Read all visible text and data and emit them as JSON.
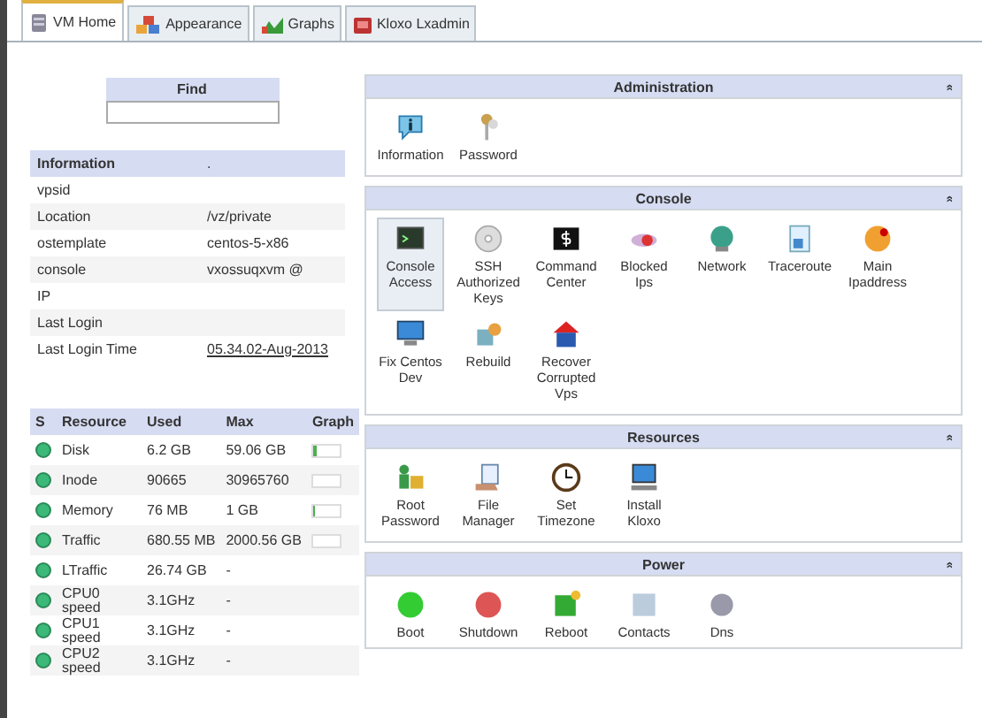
{
  "tabs": [
    {
      "label": "VM Home",
      "selected": true
    },
    {
      "label": "Appearance",
      "selected": false
    },
    {
      "label": "Graphs",
      "selected": false
    },
    {
      "label": "Kloxo Lxadmin",
      "selected": false
    }
  ],
  "find": {
    "title": "Find"
  },
  "information": {
    "header": [
      "Information",
      "."
    ],
    "rows": [
      {
        "label": "vpsid"
      },
      {
        "label": "Location",
        "value": "/vz/private"
      },
      {
        "label": "ostemplate",
        "value": "centos-5-x86"
      },
      {
        "label": "console",
        "value": "vxossuqxvm @"
      },
      {
        "label": "IP"
      },
      {
        "label": "Last Login"
      },
      {
        "label": "Last Login Time",
        "value": "05.34.02-Aug-2013",
        "link": true
      }
    ]
  },
  "resources": {
    "columns": [
      "S",
      "Resource",
      "Used",
      "Max",
      "Graph"
    ],
    "rows": [
      {
        "resource": "Disk",
        "used": "6.2 GB",
        "max": "59.06 GB",
        "level": 0.08
      },
      {
        "resource": "Inode",
        "used": "90665",
        "max": "30965760",
        "level": 0
      },
      {
        "resource": "Memory",
        "used": "76 MB",
        "max": "1 GB",
        "level": 0.07
      },
      {
        "resource": "Traffic",
        "used": "680.55 MB",
        "max": "2000.56 GB",
        "level": 0
      },
      {
        "resource": "LTraffic",
        "used": "26.74 GB",
        "max": "-"
      },
      {
        "resource": "CPU0 speed",
        "used": "3.1GHz",
        "max": "-"
      },
      {
        "resource": "CPU1 speed",
        "used": "3.1GHz",
        "max": "-"
      },
      {
        "resource": "CPU2 speed",
        "used": "3.1GHz",
        "max": "-"
      }
    ]
  },
  "panels": [
    {
      "title": "Administration",
      "collapse": "»",
      "items": [
        {
          "label": "Information",
          "selected": false
        },
        {
          "label": "Password",
          "selected": false
        }
      ]
    },
    {
      "title": "Console",
      "collapse": "»",
      "items": [
        {
          "label": "Console Access",
          "selected": true
        },
        {
          "label": "SSH Authorized Keys",
          "selected": false
        },
        {
          "label": "Command Center",
          "selected": false
        },
        {
          "label": "Blocked Ips",
          "selected": false
        },
        {
          "label": "Network",
          "selected": false
        },
        {
          "label": "Traceroute",
          "selected": false
        },
        {
          "label": "Main Ipaddress",
          "selected": false
        },
        {
          "label": "Fix Centos Dev",
          "selected": false
        },
        {
          "label": "Rebuild",
          "selected": false
        },
        {
          "label": "Recover Corrupted Vps",
          "selected": false
        }
      ]
    },
    {
      "title": "Resources",
      "collapse": "»",
      "items": [
        {
          "label": "Root Password",
          "selected": false
        },
        {
          "label": "File Manager",
          "selected": false
        },
        {
          "label": "Set Timezone",
          "selected": false
        },
        {
          "label": "Install Kloxo",
          "selected": false
        }
      ]
    },
    {
      "title": "Power",
      "collapse": "»",
      "items": [
        {
          "label": "Boot",
          "selected": false
        },
        {
          "label": "Shutdown",
          "selected": false
        },
        {
          "label": "Reboot",
          "selected": false
        },
        {
          "label": "Contacts",
          "selected": false
        },
        {
          "label": "Dns",
          "selected": false
        }
      ]
    }
  ]
}
